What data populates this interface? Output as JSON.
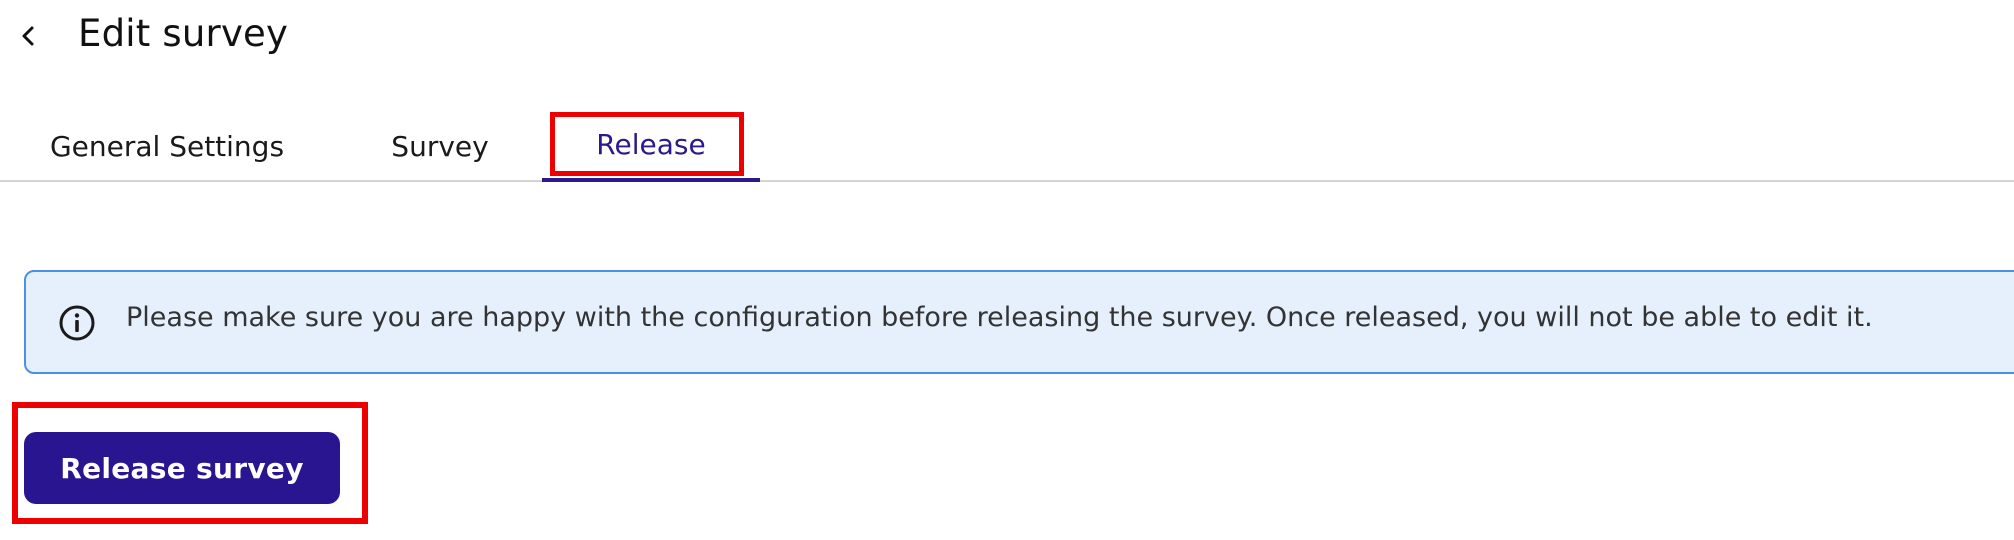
{
  "header": {
    "back_icon": "chevron-left-icon",
    "title": "Edit survey"
  },
  "tabs": [
    {
      "label": "General Settings",
      "active": false
    },
    {
      "label": "Survey",
      "active": false
    },
    {
      "label": "Release",
      "active": true
    }
  ],
  "info_banner": {
    "icon": "info-icon",
    "message": "Please make sure you are happy with the configuration before releasing the survey. Once released, you will not be able to edit it."
  },
  "actions": {
    "release_label": "Release survey"
  },
  "colors": {
    "accent": "#2a1590",
    "active_tab": "#2a1a8c",
    "banner_bg": "#e6f0fc",
    "banner_border": "#4a8fe8",
    "highlight": "#ee0000"
  }
}
